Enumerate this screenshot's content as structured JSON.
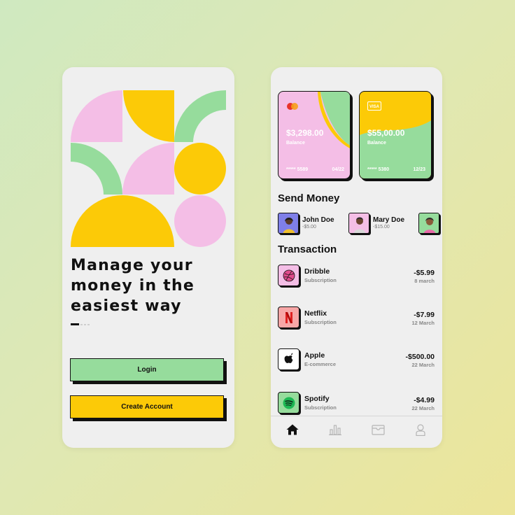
{
  "onboarding": {
    "headline": "Manage your money in the easiest way",
    "login_label": "Login",
    "create_account_label": "Create Account"
  },
  "cards": [
    {
      "amount": "$3,298.00",
      "label": "Balance",
      "number": "***** 5589",
      "expiry": "04/22",
      "brand_icon": "mastercard-icon"
    },
    {
      "amount": "$55,00.00",
      "label": "Balance",
      "number": "***** 5380",
      "expiry": "12/23",
      "brand_icon": "visa-icon"
    }
  ],
  "send_money": {
    "title": "Send Money",
    "contacts": [
      {
        "name": "John Doe",
        "amount": "-$5.00"
      },
      {
        "name": "Mary Doe",
        "amount": "-$15.00"
      }
    ]
  },
  "transactions": {
    "title": "Transaction",
    "items": [
      {
        "name": "Dribble",
        "type": "Subscription",
        "amount": "-$5.99",
        "date": "8 march",
        "icon": "dribbble-icon"
      },
      {
        "name": "Netflix",
        "type": "Subscription",
        "amount": "-$7.99",
        "date": "12 March",
        "icon": "netflix-icon"
      },
      {
        "name": "Apple",
        "type": "E-commerce",
        "amount": "-$500.00",
        "date": "22 March",
        "icon": "apple-icon"
      },
      {
        "name": "Spotify",
        "type": "Subscription",
        "amount": "-$4.99",
        "date": "22 March",
        "icon": "spotify-icon"
      }
    ]
  },
  "tabbar": [
    "home-icon",
    "stats-icon",
    "wallet-icon",
    "profile-icon"
  ],
  "colors": {
    "pink": "#f4bee6",
    "yellow": "#fcca07",
    "green": "#96dc9c",
    "dark": "#111111",
    "background": "#efefef"
  }
}
